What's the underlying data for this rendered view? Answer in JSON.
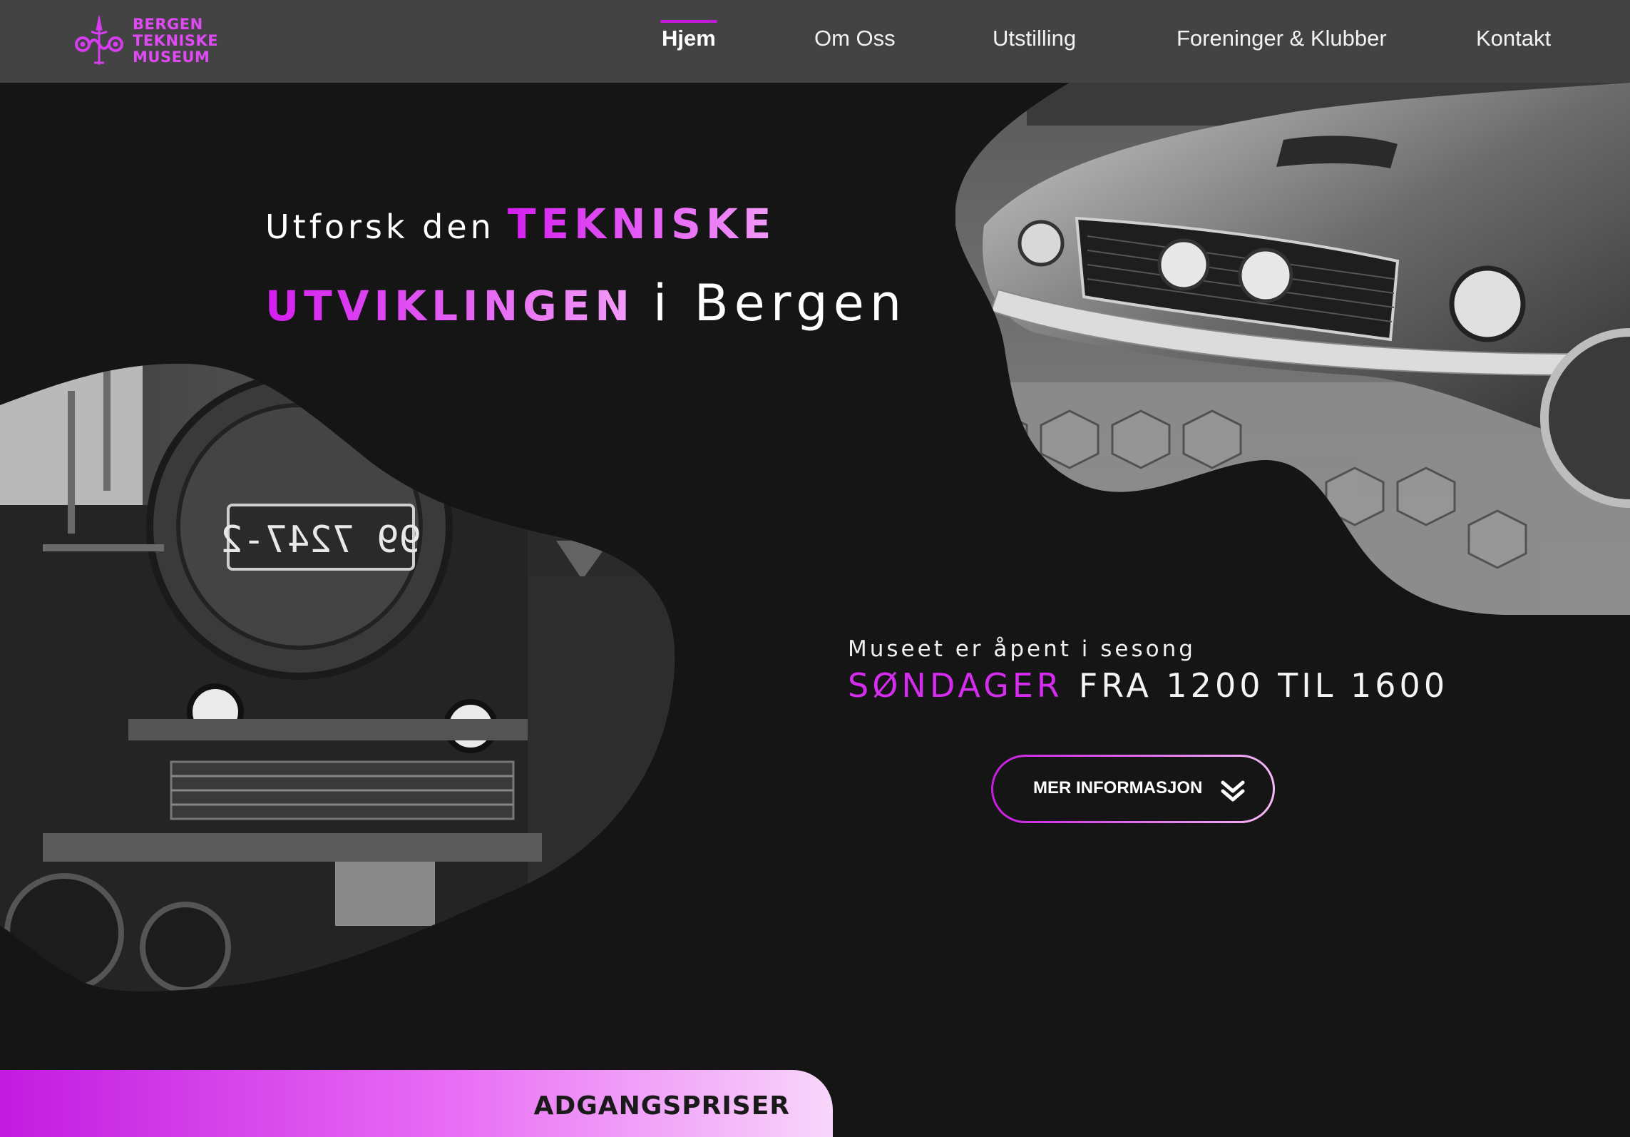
{
  "logo": {
    "lines": [
      "BERGEN",
      "TEKNISKE",
      "MUSEUM"
    ]
  },
  "nav": {
    "items": [
      {
        "label": "Hjem",
        "active": true
      },
      {
        "label": "Om Oss",
        "active": false
      },
      {
        "label": "Utstilling",
        "active": false
      },
      {
        "label": "Foreninger & Klubber",
        "active": false
      },
      {
        "label": "Kontakt",
        "active": false
      }
    ]
  },
  "hero": {
    "line1_prefix": "Utforsk den",
    "line1_accent": "TEKNISKE",
    "line2_accent": "UTVIKLINGEN",
    "line2_suffix": "i Bergen"
  },
  "images": {
    "car": "car-photo",
    "train": "steam-locomotive-photo",
    "train_plate": "99 7247-2"
  },
  "info": {
    "open_text": "Museet er åpent i sesong",
    "day": "SØNDAGER",
    "time": "FRA 1200 TIL 1600",
    "button_label": "MER INFORMASJON",
    "button_icon": "double-chevron-down-icon"
  },
  "prices": {
    "label": "ADGANGSPRISER"
  },
  "colors": {
    "accent": "#d41ef0",
    "accent_light": "#f39cf8",
    "header_bg": "#434344",
    "page_bg": "#151516"
  }
}
